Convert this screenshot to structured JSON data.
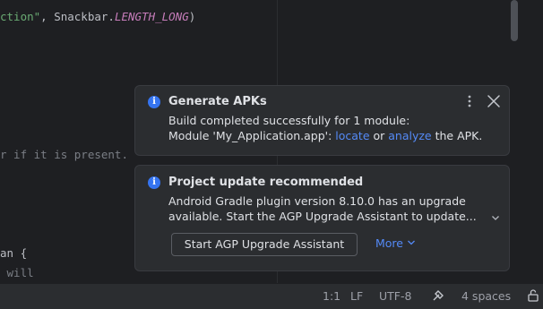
{
  "editor": {
    "line1": {
      "string_part": "ction\"",
      "plain_part": ", Snackbar.",
      "const_part": "LENGTH_LONG",
      "tail": ")"
    },
    "line2_comment": "r if it is present.",
    "line3": "an {",
    "line4_comment": " will"
  },
  "notifications": [
    {
      "title": "Generate APKs",
      "body_line1": "Build completed successfully for 1 module:",
      "body_line2_prefix": "Module 'My_Application.app': ",
      "link_locate": "locate",
      "middle": " or ",
      "link_analyze": "analyze",
      "suffix": " the APK."
    },
    {
      "title": "Project update recommended",
      "body_line1": "Android Gradle plugin version 8.10.0 has an upgrade",
      "body_line2": "available. Start the AGP Upgrade Assistant to update...",
      "action_button": "Start AGP Upgrade Assistant",
      "more_label": "More"
    }
  ],
  "status_bar": {
    "position": "1:1",
    "line_ending": "LF",
    "encoding": "UTF-8",
    "indent": "4 spaces"
  },
  "colors": {
    "accent": "#3574f0",
    "link": "#548af7",
    "background": "#1e1f22",
    "panel": "#2b2d30"
  }
}
